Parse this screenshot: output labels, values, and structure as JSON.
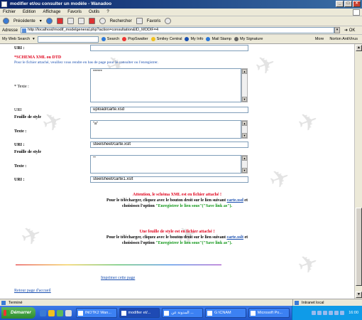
{
  "window": {
    "title": "modifier et/ou consulter un modèle - Wanadoo"
  },
  "menu": [
    "Fichier",
    "Edition",
    "Affichage",
    "Favoris",
    "Outils",
    "?"
  ],
  "toolbar": {
    "back": "Précédente",
    "search": "Rechercher",
    "favorites": "Favoris"
  },
  "address": {
    "label": "Adresse",
    "url": "http://localhost/modif_modelgeneral.php?action=consultation&ID_MODIF=4",
    "go": "OK"
  },
  "links": {
    "search_label": "My Web Search",
    "search_btn": "Search",
    "items": [
      "PopSwatter",
      "Smiley Central",
      "My Info",
      "Mail Stamp",
      "My Signature"
    ],
    "more": "More",
    "antivirus": "Norton AntiVirus"
  },
  "form": {
    "uri_label": "URI :",
    "uri_value": "",
    "schema_heading": "*SCHEMA XML ou DTD",
    "schema_note": "Pour le fichier attaché, veuillez vous rendre en bas de page pour le consulter ou l'enregistrer.",
    "texte_label": "* Texte :",
    "texte_value": "******",
    "uri2_label": "URI",
    "uri2_value": "upload/carte.xsd",
    "style1_heading": "Feuille de style",
    "texte2_label": "Texte :",
    "texte2_value": "\"a\"",
    "uri3_label": "URI :",
    "uri3_value": "steelsheet/carte.xslt",
    "style2_heading": "Feuille de style",
    "texte3_label": "Texte :",
    "texte3_value": "\"\"",
    "uri4_label": "URI :",
    "uri4_value": "steelsheet/carte1.xslt"
  },
  "notice1": {
    "warning": "Attention, le schéma XML est en fichier attaché !",
    "line1_pre": "Pour le télécharger, cliquez avec le bouton droit sur le lien suivant",
    "line1_link": "carte.xsd",
    "line1_post": "et",
    "line2_pre": "choisissez l'option",
    "line2_option": "\"Enregistrer le lien sous\"(\"Save link as\")."
  },
  "notice2": {
    "warning": "Une feuille de style est en fichier attaché !",
    "line1_pre": "Pour le télécharger, cliquez avec le bouton droit sur le lien suivant",
    "line1_link": "carte.xslt",
    "line1_post": "et",
    "line2_pre": "choisissez l'option",
    "line2_option": "\"Enregistrer le lien sous\"(\"Save link as\")."
  },
  "print_link": "Imprimer cette page",
  "home_link": "Retour page d'accueil",
  "status": {
    "text": "Terminé",
    "zone": "Intranet local"
  },
  "taskbar": {
    "start": "Démarrer",
    "tasks": [
      "INOTK2 Wan...",
      "modifier et/...",
      "المدونة عن ...",
      "G:\\CNAM",
      "Microsoft Po..."
    ],
    "clock": "16:00"
  }
}
